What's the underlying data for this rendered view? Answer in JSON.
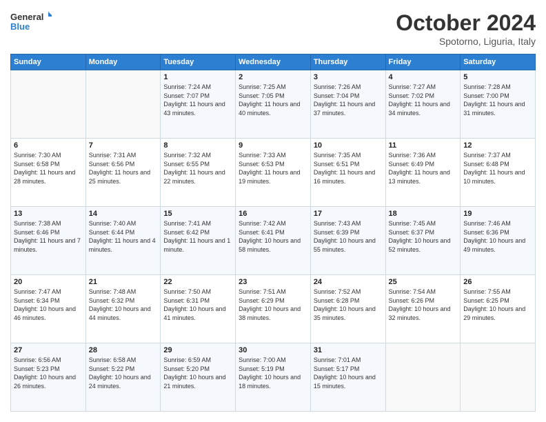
{
  "logo": {
    "line1": "General",
    "line2": "Blue"
  },
  "title": "October 2024",
  "location": "Spotorno, Liguria, Italy",
  "days_header": [
    "Sunday",
    "Monday",
    "Tuesday",
    "Wednesday",
    "Thursday",
    "Friday",
    "Saturday"
  ],
  "weeks": [
    [
      {
        "day": "",
        "content": ""
      },
      {
        "day": "",
        "content": ""
      },
      {
        "day": "1",
        "content": "Sunrise: 7:24 AM\nSunset: 7:07 PM\nDaylight: 11 hours and 43 minutes."
      },
      {
        "day": "2",
        "content": "Sunrise: 7:25 AM\nSunset: 7:05 PM\nDaylight: 11 hours and 40 minutes."
      },
      {
        "day": "3",
        "content": "Sunrise: 7:26 AM\nSunset: 7:04 PM\nDaylight: 11 hours and 37 minutes."
      },
      {
        "day": "4",
        "content": "Sunrise: 7:27 AM\nSunset: 7:02 PM\nDaylight: 11 hours and 34 minutes."
      },
      {
        "day": "5",
        "content": "Sunrise: 7:28 AM\nSunset: 7:00 PM\nDaylight: 11 hours and 31 minutes."
      }
    ],
    [
      {
        "day": "6",
        "content": "Sunrise: 7:30 AM\nSunset: 6:58 PM\nDaylight: 11 hours and 28 minutes."
      },
      {
        "day": "7",
        "content": "Sunrise: 7:31 AM\nSunset: 6:56 PM\nDaylight: 11 hours and 25 minutes."
      },
      {
        "day": "8",
        "content": "Sunrise: 7:32 AM\nSunset: 6:55 PM\nDaylight: 11 hours and 22 minutes."
      },
      {
        "day": "9",
        "content": "Sunrise: 7:33 AM\nSunset: 6:53 PM\nDaylight: 11 hours and 19 minutes."
      },
      {
        "day": "10",
        "content": "Sunrise: 7:35 AM\nSunset: 6:51 PM\nDaylight: 11 hours and 16 minutes."
      },
      {
        "day": "11",
        "content": "Sunrise: 7:36 AM\nSunset: 6:49 PM\nDaylight: 11 hours and 13 minutes."
      },
      {
        "day": "12",
        "content": "Sunrise: 7:37 AM\nSunset: 6:48 PM\nDaylight: 11 hours and 10 minutes."
      }
    ],
    [
      {
        "day": "13",
        "content": "Sunrise: 7:38 AM\nSunset: 6:46 PM\nDaylight: 11 hours and 7 minutes."
      },
      {
        "day": "14",
        "content": "Sunrise: 7:40 AM\nSunset: 6:44 PM\nDaylight: 11 hours and 4 minutes."
      },
      {
        "day": "15",
        "content": "Sunrise: 7:41 AM\nSunset: 6:42 PM\nDaylight: 11 hours and 1 minute."
      },
      {
        "day": "16",
        "content": "Sunrise: 7:42 AM\nSunset: 6:41 PM\nDaylight: 10 hours and 58 minutes."
      },
      {
        "day": "17",
        "content": "Sunrise: 7:43 AM\nSunset: 6:39 PM\nDaylight: 10 hours and 55 minutes."
      },
      {
        "day": "18",
        "content": "Sunrise: 7:45 AM\nSunset: 6:37 PM\nDaylight: 10 hours and 52 minutes."
      },
      {
        "day": "19",
        "content": "Sunrise: 7:46 AM\nSunset: 6:36 PM\nDaylight: 10 hours and 49 minutes."
      }
    ],
    [
      {
        "day": "20",
        "content": "Sunrise: 7:47 AM\nSunset: 6:34 PM\nDaylight: 10 hours and 46 minutes."
      },
      {
        "day": "21",
        "content": "Sunrise: 7:48 AM\nSunset: 6:32 PM\nDaylight: 10 hours and 44 minutes."
      },
      {
        "day": "22",
        "content": "Sunrise: 7:50 AM\nSunset: 6:31 PM\nDaylight: 10 hours and 41 minutes."
      },
      {
        "day": "23",
        "content": "Sunrise: 7:51 AM\nSunset: 6:29 PM\nDaylight: 10 hours and 38 minutes."
      },
      {
        "day": "24",
        "content": "Sunrise: 7:52 AM\nSunset: 6:28 PM\nDaylight: 10 hours and 35 minutes."
      },
      {
        "day": "25",
        "content": "Sunrise: 7:54 AM\nSunset: 6:26 PM\nDaylight: 10 hours and 32 minutes."
      },
      {
        "day": "26",
        "content": "Sunrise: 7:55 AM\nSunset: 6:25 PM\nDaylight: 10 hours and 29 minutes."
      }
    ],
    [
      {
        "day": "27",
        "content": "Sunrise: 6:56 AM\nSunset: 5:23 PM\nDaylight: 10 hours and 26 minutes."
      },
      {
        "day": "28",
        "content": "Sunrise: 6:58 AM\nSunset: 5:22 PM\nDaylight: 10 hours and 24 minutes."
      },
      {
        "day": "29",
        "content": "Sunrise: 6:59 AM\nSunset: 5:20 PM\nDaylight: 10 hours and 21 minutes."
      },
      {
        "day": "30",
        "content": "Sunrise: 7:00 AM\nSunset: 5:19 PM\nDaylight: 10 hours and 18 minutes."
      },
      {
        "day": "31",
        "content": "Sunrise: 7:01 AM\nSunset: 5:17 PM\nDaylight: 10 hours and 15 minutes."
      },
      {
        "day": "",
        "content": ""
      },
      {
        "day": "",
        "content": ""
      }
    ]
  ]
}
